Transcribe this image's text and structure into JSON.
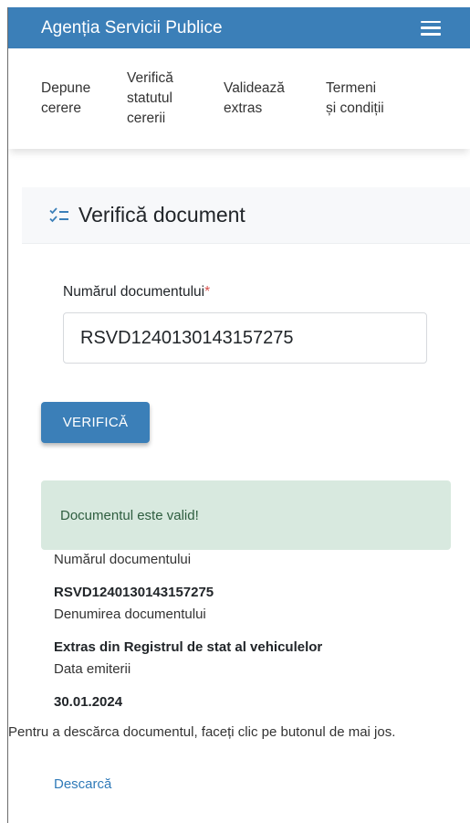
{
  "header": {
    "brand": "Agenția Servicii Publice",
    "menu_icon": "hamburger-menu-icon"
  },
  "nav": {
    "items": [
      {
        "label": "Depune cerere"
      },
      {
        "label": "Verifică statutul cererii"
      },
      {
        "label": "Validează extras"
      },
      {
        "label": "Termeni și condiții"
      }
    ]
  },
  "page": {
    "title": "Verifică document",
    "title_icon": "checklist-icon"
  },
  "form": {
    "label": "Numărul documentului",
    "required_mark": "*",
    "value": "RSVD1240130143157275",
    "submit_label": "VERIFICĂ"
  },
  "result": {
    "alert": "Documentul este valid!",
    "number_label": "Numărul documentului",
    "number_value": "RSVD1240130143157275",
    "name_label": "Denumirea documentului",
    "name_value": "Extras din Registrul de stat al vehiculelor",
    "date_label": "Data emiterii",
    "date_value": "30.01.2024",
    "note": "Pentru a descărca documentul, faceți clic pe butonul de mai jos.",
    "download_label": "Descarcă"
  },
  "colors": {
    "primary": "#3b7fb8",
    "success_bg": "#d8e9df",
    "success_text": "#2f5e40",
    "link": "#2f7ab8",
    "required": "#d9534f"
  }
}
